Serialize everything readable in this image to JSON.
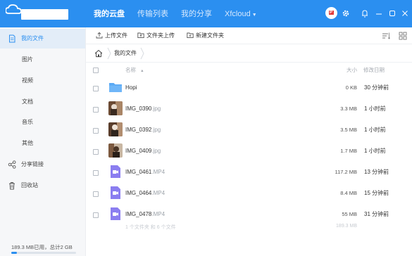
{
  "colors": {
    "brand": "#2b8ff0",
    "sidebar_bg": "#f6f7f9",
    "active_bg": "#e3edf8",
    "folder": "#5aa9f5",
    "video": "#8b7ef0"
  },
  "header": {
    "tabs": [
      {
        "label": "我的云盘",
        "active": true
      },
      {
        "label": "传输列表",
        "active": false
      },
      {
        "label": "我的分享",
        "active": false
      },
      {
        "label": "Xfcloud",
        "active": false
      }
    ],
    "icons": [
      "avatar-icon",
      "gear-icon",
      "bell-icon",
      "minimize-icon",
      "maximize-icon",
      "close-icon"
    ]
  },
  "sidebar": {
    "items": [
      {
        "label": "我的文件",
        "icon": "document-icon",
        "active": true
      },
      {
        "label": "图片"
      },
      {
        "label": "视频"
      },
      {
        "label": "文档"
      },
      {
        "label": "音乐"
      },
      {
        "label": "其他"
      },
      {
        "label": "分享链接",
        "icon": "share-icon"
      },
      {
        "label": "回收站",
        "icon": "trash-icon"
      }
    ],
    "storage": {
      "text": "189.3 MB已用，总计2 GB",
      "used_fraction": 0.092
    }
  },
  "toolbar": {
    "upload_file": "上传文件",
    "upload_folder": "文件夹上传",
    "new_folder": "新建文件夹",
    "icons": [
      "sort-icon",
      "grid-view-icon"
    ]
  },
  "breadcrumb": {
    "current": "我的文件"
  },
  "table": {
    "headers": {
      "name": "名称",
      "sort": "▲",
      "size": "大小",
      "date": "修改日期"
    },
    "rows": [
      {
        "name": "Hopi",
        "ext": "",
        "size": "0 KB",
        "date": "30 分钟前",
        "type": "folder"
      },
      {
        "name": "IMG_0390",
        "ext": ".jpg",
        "size": "3.3 MB",
        "date": "1 小时前",
        "type": "image"
      },
      {
        "name": "IMG_0392",
        "ext": ".jpg",
        "size": "3.5 MB",
        "date": "1 小时前",
        "type": "image"
      },
      {
        "name": "IMG_0409",
        "ext": ".jpg",
        "size": "1.7 MB",
        "date": "1 小时前",
        "type": "image"
      },
      {
        "name": "IMG_0461",
        "ext": ".MP4",
        "size": "117.2 MB",
        "date": "13 分钟前",
        "type": "video"
      },
      {
        "name": "IMG_0464",
        "ext": ".MP4",
        "size": "8.4 MB",
        "date": "15 分钟前",
        "type": "video"
      },
      {
        "name": "IMG_0478",
        "ext": ".MP4",
        "size": "55 MB",
        "date": "31 分钟前",
        "type": "video"
      }
    ]
  },
  "footer": {
    "count": "1 个文件夹 和 6 个文件",
    "total": "189.3 MB"
  }
}
